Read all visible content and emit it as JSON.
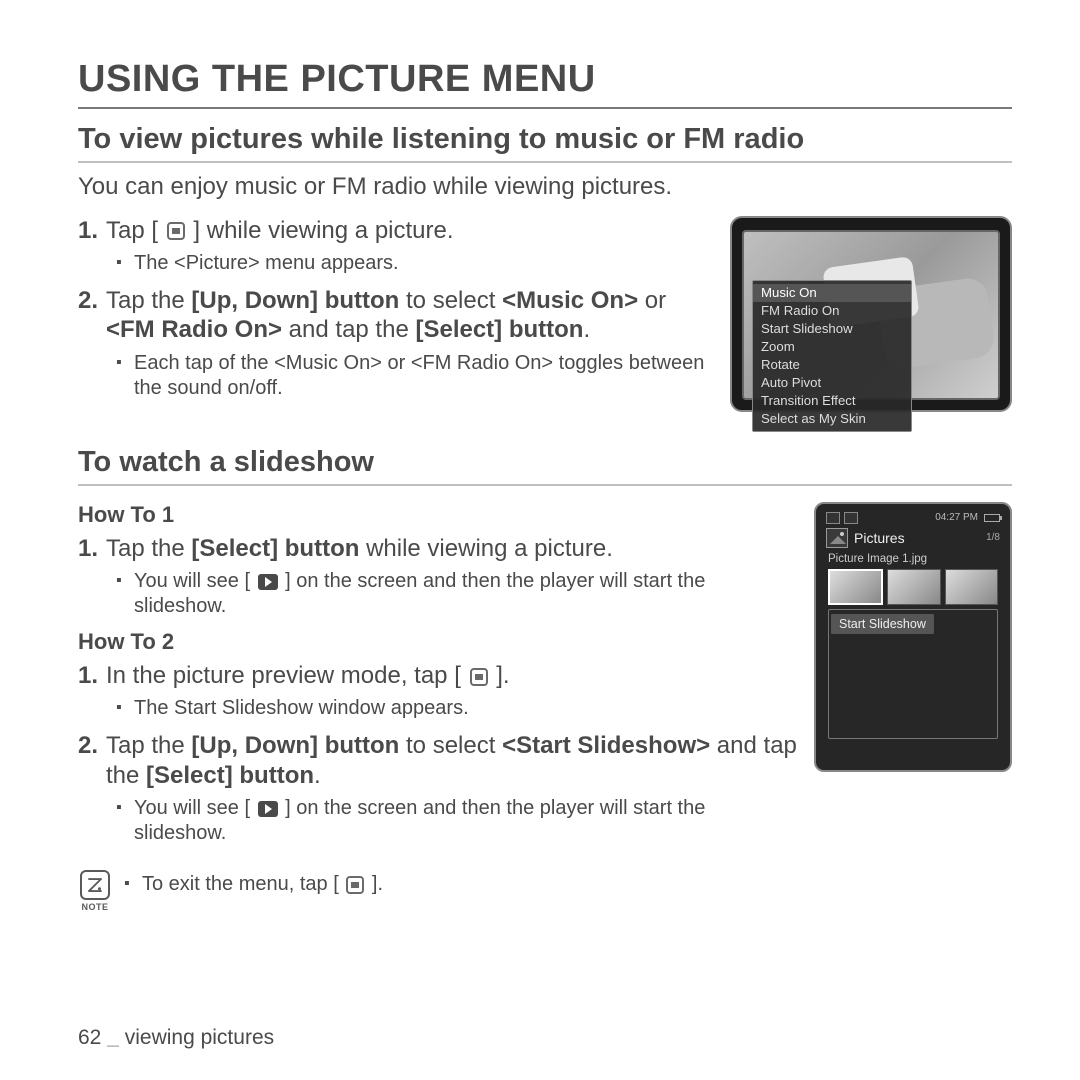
{
  "page": {
    "title": "USING THE PICTURE MENU",
    "number": "62",
    "sep": " _ ",
    "section_name": "viewing pictures"
  },
  "sec1": {
    "heading": "To view pictures while listening to music or FM radio",
    "intro": "You can enjoy music or FM radio while viewing pictures.",
    "step1_a": "Tap ",
    "step1_b": "[ ",
    "step1_c": " ]",
    "step1_d": " while viewing a picture.",
    "step1_sub": "The <Picture> menu appears.",
    "step2_a": "Tap the ",
    "step2_b": "[Up, Down] button",
    "step2_c": " to select ",
    "step2_d": "<Music On>",
    "step2_e": " or ",
    "step2_f": "<FM Radio On>",
    "step2_g": " and tap the ",
    "step2_h": "[Select] button",
    "step2_i": ".",
    "step2_sub": "Each tap of the <Music On> or <FM Radio On> toggles between the sound on/off."
  },
  "fig1_menu": [
    "Music On",
    "FM Radio On",
    "Start Slideshow",
    "Zoom",
    "Rotate",
    "Auto Pivot",
    "Transition Effect",
    "Select as My Skin"
  ],
  "sec2": {
    "heading": "To watch a slideshow",
    "howto1": "How To 1",
    "h1_step1_a": "Tap the ",
    "h1_step1_b": "[Select] button",
    "h1_step1_c": " while viewing a picture.",
    "h1_sub_a": "You will see [ ",
    "h1_sub_b": " ] on the screen and then the player will start the slideshow.",
    "howto2": "How To 2",
    "h2_step1_a": "In the picture preview mode, tap ",
    "h2_step1_b": "[ ",
    "h2_step1_c": " ]",
    "h2_step1_d": ".",
    "h2_step1_sub": "The Start Slideshow window appears.",
    "h2_step2_a": "Tap the ",
    "h2_step2_b": "[Up, Down] button",
    "h2_step2_c": " to select ",
    "h2_step2_d": "<Start Slideshow>",
    "h2_step2_e": " and tap the ",
    "h2_step2_f": "[Select] button",
    "h2_step2_g": ".",
    "h2_step2_sub_a": "You will see [ ",
    "h2_step2_sub_b": " ] on the screen and then the player will start the slideshow."
  },
  "fig2": {
    "time": "04:27 PM",
    "title": "Pictures",
    "count": "1/8",
    "filename": "Picture Image 1.jpg",
    "menu_item": "Start Slideshow"
  },
  "note": {
    "label": "NOTE",
    "text_a": "To exit the menu, tap [ ",
    "text_b": " ]."
  }
}
